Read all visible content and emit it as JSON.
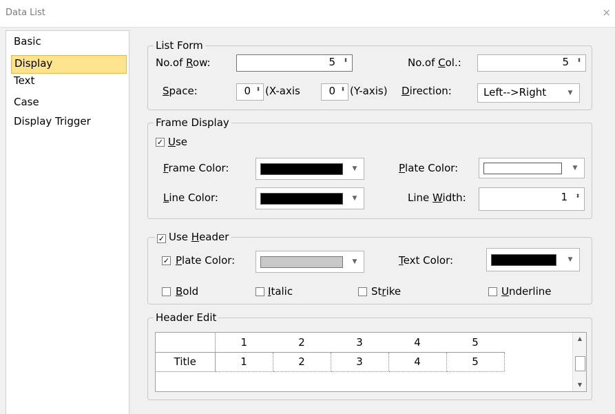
{
  "window": {
    "title": "Data List",
    "close_glyph": "×"
  },
  "sidebar": {
    "items": [
      "Basic",
      "Display",
      "Text",
      "Case",
      "Display Trigger"
    ]
  },
  "list_form": {
    "legend": "List Form",
    "row_label_pre": "No.of ",
    "row_label_key": "R",
    "row_label_post": "ow:",
    "row_value": "5",
    "col_label_pre": "No.of ",
    "col_label_key": "C",
    "col_label_post": "ol.:",
    "col_value": "5",
    "space_label_key": "S",
    "space_label_post": "pace:",
    "x_value": "0",
    "x_axis_label": "(X-axis",
    "y_value": "0",
    "y_axis_label": "(Y-axis)",
    "direction_label_key": "D",
    "direction_label_post": "irection:",
    "direction_value": "Left-->Right"
  },
  "frame_display": {
    "legend": "Frame Display",
    "use_label_key": "U",
    "use_label_post": "se",
    "use_checked": true,
    "frame_color_label_key": "F",
    "frame_color_label_post": "rame Color:",
    "frame_color": "#000000",
    "plate_color_label_key": "P",
    "plate_color_label_post": "late Color:",
    "plate_color": "#ffffff",
    "line_color_label_key": "L",
    "line_color_label_post": "ine Color:",
    "line_color": "#000000",
    "line_width_label_pre": "Line ",
    "line_width_label_key": "W",
    "line_width_label_post": "idth:",
    "line_width_value": "1"
  },
  "use_header": {
    "legend_pre": "Use ",
    "legend_key": "H",
    "legend_post": "eader",
    "checked": true,
    "plate_label_key": "P",
    "plate_label_post": "late Color:",
    "plate_checked": true,
    "plate_color": "#c8c8c8",
    "text_color_label_key": "T",
    "text_color_label_post": "ext Color:",
    "text_color": "#000000",
    "bold_key": "B",
    "bold_post": "old",
    "italic_key": "I",
    "italic_post": "talic",
    "strike_pre": "St",
    "strike_key": "r",
    "strike_post": "ike",
    "underline_key": "U",
    "underline_post": "nderline"
  },
  "header_edit": {
    "legend": "Header Edit",
    "columns": [
      "",
      "1",
      "2",
      "3",
      "4",
      "5"
    ],
    "row_label": "Title",
    "row_values": [
      "1",
      "2",
      "3",
      "4",
      "5"
    ]
  },
  "icons": {
    "spinner": "⬍",
    "dropdown": "▼",
    "check": "✓"
  }
}
